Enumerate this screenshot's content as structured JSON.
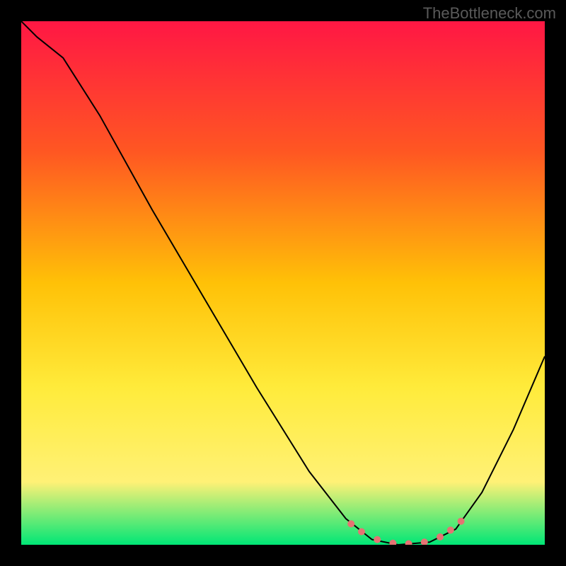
{
  "watermark": "TheBottleneck.com",
  "chart_data": {
    "type": "line",
    "title": "",
    "xlabel": "",
    "ylabel": "",
    "xlim": [
      0,
      100
    ],
    "ylim": [
      0,
      100
    ],
    "gradient_colors": {
      "top": "#ff1744",
      "upper_mid": "#ff5722",
      "mid": "#ffc107",
      "lower_mid": "#ffeb3b",
      "lower": "#fff176",
      "bottom": "#00e676"
    },
    "curve": {
      "description": "V-shaped bottleneck curve descending from top-left to a trough region and rising to right edge",
      "points": [
        {
          "x": 0,
          "y": 100
        },
        {
          "x": 3,
          "y": 97
        },
        {
          "x": 8,
          "y": 93
        },
        {
          "x": 15,
          "y": 82
        },
        {
          "x": 25,
          "y": 64
        },
        {
          "x": 35,
          "y": 47
        },
        {
          "x": 45,
          "y": 30
        },
        {
          "x": 55,
          "y": 14
        },
        {
          "x": 62,
          "y": 5
        },
        {
          "x": 67,
          "y": 1
        },
        {
          "x": 72,
          "y": 0
        },
        {
          "x": 78,
          "y": 0.5
        },
        {
          "x": 83,
          "y": 3
        },
        {
          "x": 88,
          "y": 10
        },
        {
          "x": 94,
          "y": 22
        },
        {
          "x": 100,
          "y": 36
        }
      ]
    },
    "trough_markers": {
      "color": "#e57373",
      "points": [
        {
          "x": 63,
          "y": 4
        },
        {
          "x": 65,
          "y": 2.5
        },
        {
          "x": 68,
          "y": 1
        },
        {
          "x": 71,
          "y": 0.3
        },
        {
          "x": 74,
          "y": 0.2
        },
        {
          "x": 77,
          "y": 0.5
        },
        {
          "x": 80,
          "y": 1.5
        },
        {
          "x": 82,
          "y": 2.8
        },
        {
          "x": 84,
          "y": 4.5
        }
      ]
    }
  }
}
